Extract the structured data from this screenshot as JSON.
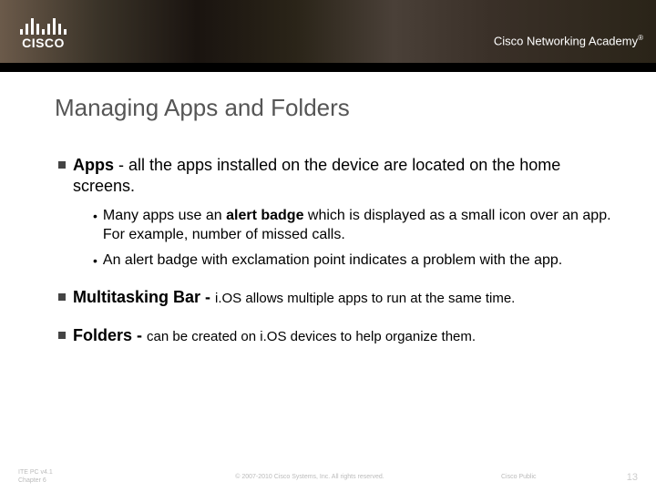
{
  "header": {
    "logo_text": "CISCO",
    "academy": "Cisco Networking Academy"
  },
  "title": "Managing Apps and Folders",
  "bullets": {
    "apps": {
      "lead": "Apps",
      "rest": " - all the apps installed on the device are located on the home screens.",
      "sub1_pre": "Many apps use an ",
      "sub1_bold": "alert badge",
      "sub1_post": " which is displayed as a small icon over an app. For example, number of missed calls.",
      "sub2": "An alert badge with exclamation point indicates a problem with the app."
    },
    "multitask": {
      "lead": "Multitasking Bar - ",
      "tail": "i.OS allows multiple apps to run at the same time."
    },
    "folders": {
      "lead": "Folders - ",
      "tail": "can be created on i.OS devices to help organize them."
    }
  },
  "footer": {
    "left1": "ITE PC v4.1",
    "left2": "Chapter 6",
    "center": "© 2007-2010 Cisco Systems, Inc. All rights reserved.",
    "right1": "Cisco Public",
    "page": "13"
  }
}
